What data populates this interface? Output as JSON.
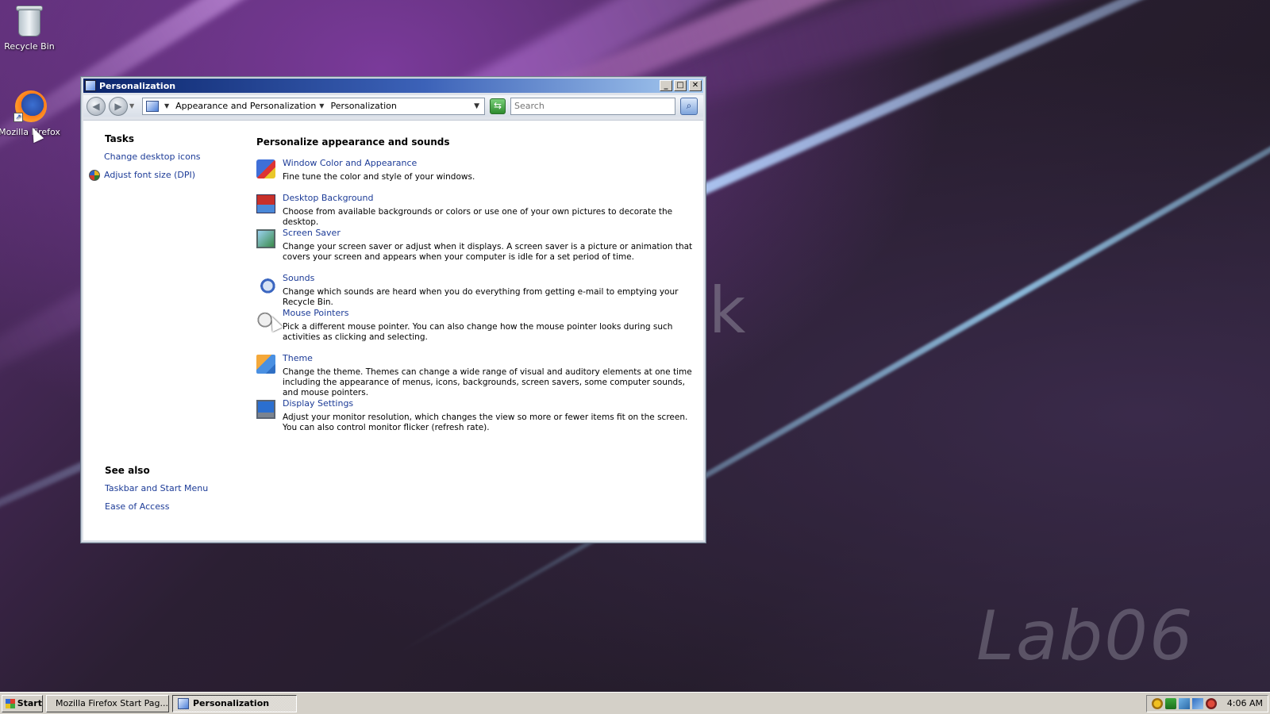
{
  "desktop": {
    "watermark": "Lab06",
    "watermark_letter": "k",
    "icons": [
      {
        "label": "Recycle Bin",
        "icon": "recycle-bin-icon"
      },
      {
        "label": "Mozilla Firefox",
        "icon": "firefox-icon"
      }
    ]
  },
  "window": {
    "title": "Personalization",
    "controls": {
      "minimize": "_",
      "maximize": "□",
      "close": "✕"
    },
    "address": {
      "crumbs": [
        "Appearance and Personalization",
        "Personalization"
      ],
      "search_placeholder": "Search"
    },
    "left_pane": {
      "tasks_heading": "Tasks",
      "tasks": [
        "Change desktop icons",
        "Adjust font size (DPI)"
      ],
      "see_also_heading": "See also",
      "see_also": [
        "Taskbar and Start Menu",
        "Ease of Access"
      ]
    },
    "main": {
      "heading": "Personalize appearance and sounds",
      "items": [
        {
          "title": "Window Color and Appearance",
          "description": "Fine tune the color and style of your windows.",
          "icon": "window-color-icon"
        },
        {
          "title": "Desktop Background",
          "description": "Choose from available backgrounds or colors or use one of your own pictures to decorate the desktop.",
          "icon": "desktop-background-icon"
        },
        {
          "title": "Screen Saver",
          "description": "Change your screen saver or adjust when it displays. A screen saver is a picture or animation that covers your screen and appears when your computer is idle for a set period of time.",
          "icon": "screen-saver-icon"
        },
        {
          "title": "Sounds",
          "description": "Change which sounds are heard when you do everything from getting e-mail to emptying your Recycle Bin.",
          "icon": "sounds-icon"
        },
        {
          "title": "Mouse Pointers",
          "description": "Pick a different mouse pointer. You can also change how the mouse pointer looks during such activities as clicking and selecting.",
          "icon": "mouse-pointers-icon"
        },
        {
          "title": "Theme",
          "description": "Change the theme. Themes can change a wide range of visual and auditory elements at one time including the appearance of menus, icons, backgrounds, screen savers, some computer sounds, and mouse pointers.",
          "icon": "theme-icon"
        },
        {
          "title": "Display Settings",
          "description": "Adjust your monitor resolution, which changes the view so more or fewer items fit on the screen. You can also control monitor flicker (refresh rate).",
          "icon": "display-settings-icon"
        }
      ]
    }
  },
  "taskbar": {
    "start_label": "Start",
    "tasks": [
      {
        "label": "Mozilla Firefox Start Pag...",
        "icon": "firefox-icon",
        "active": false
      },
      {
        "label": "Personalization",
        "icon": "personalization-icon",
        "active": true
      }
    ],
    "clock": "4:06 AM"
  }
}
